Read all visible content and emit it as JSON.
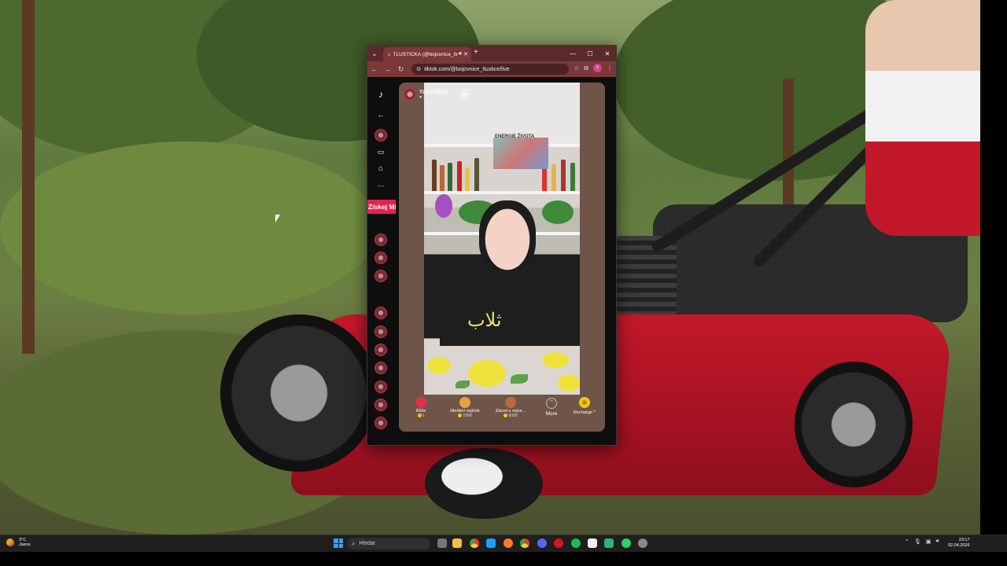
{
  "browser": {
    "tab_title": "TLUSTIČKA (@bojovnice_tlu",
    "url": "tiktok.com/@bojovnice_tlustice/live",
    "profile_initial": "Y"
  },
  "sidebar": {
    "get_coins_label": "Získej Mi"
  },
  "live": {
    "host_name": "TLUSTIČKA",
    "viewer_count": "179.5K",
    "poster_text": "ENERGIE ŽIVOTA",
    "shirt_print": "ثلاب"
  },
  "gifts": [
    {
      "name": "Růže",
      "price": "1",
      "color": "#e0304a"
    },
    {
      "name": "Hledání vajíček",
      "price": "1999",
      "color": "#e6a23c"
    },
    {
      "name": "Závod s vejce...",
      "price": "6000",
      "color": "#b86a3a"
    }
  ],
  "gift_bar": {
    "more_label": "More",
    "recharge_label": "Recharge ^"
  },
  "taskbar": {
    "weather_temp": "3°C",
    "weather_desc": "Jasno",
    "search_placeholder": "Hledat",
    "time": "23:17",
    "date": "02.04.2026"
  }
}
